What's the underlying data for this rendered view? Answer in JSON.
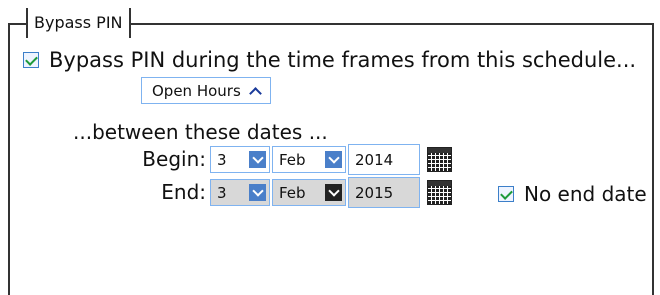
{
  "group": {
    "legend": "Bypass PIN"
  },
  "bypass_checkbox": {
    "label": "Bypass PIN during the time frames from this schedule...",
    "checked": true
  },
  "schedule_dropdown": {
    "value": "Open Hours"
  },
  "dates": {
    "heading": "...between these dates ...",
    "begin": {
      "label": "Begin:",
      "day": "3",
      "month": "Feb",
      "year": "2014"
    },
    "end": {
      "label": "End:",
      "day": "3",
      "month": "Feb",
      "year": "2015"
    }
  },
  "no_end_date": {
    "label": "No end date",
    "checked": true
  },
  "icons": {
    "calendar": "calendar-icon",
    "dropdown": "chevron-down-icon",
    "collapse": "chevron-up-icon",
    "check": "check-icon"
  },
  "colors": {
    "accent": "#4a7fc9",
    "check": "#1d9a3a",
    "field_border": "#7fb3f0",
    "disabled_bg": "#d8d8d8"
  }
}
